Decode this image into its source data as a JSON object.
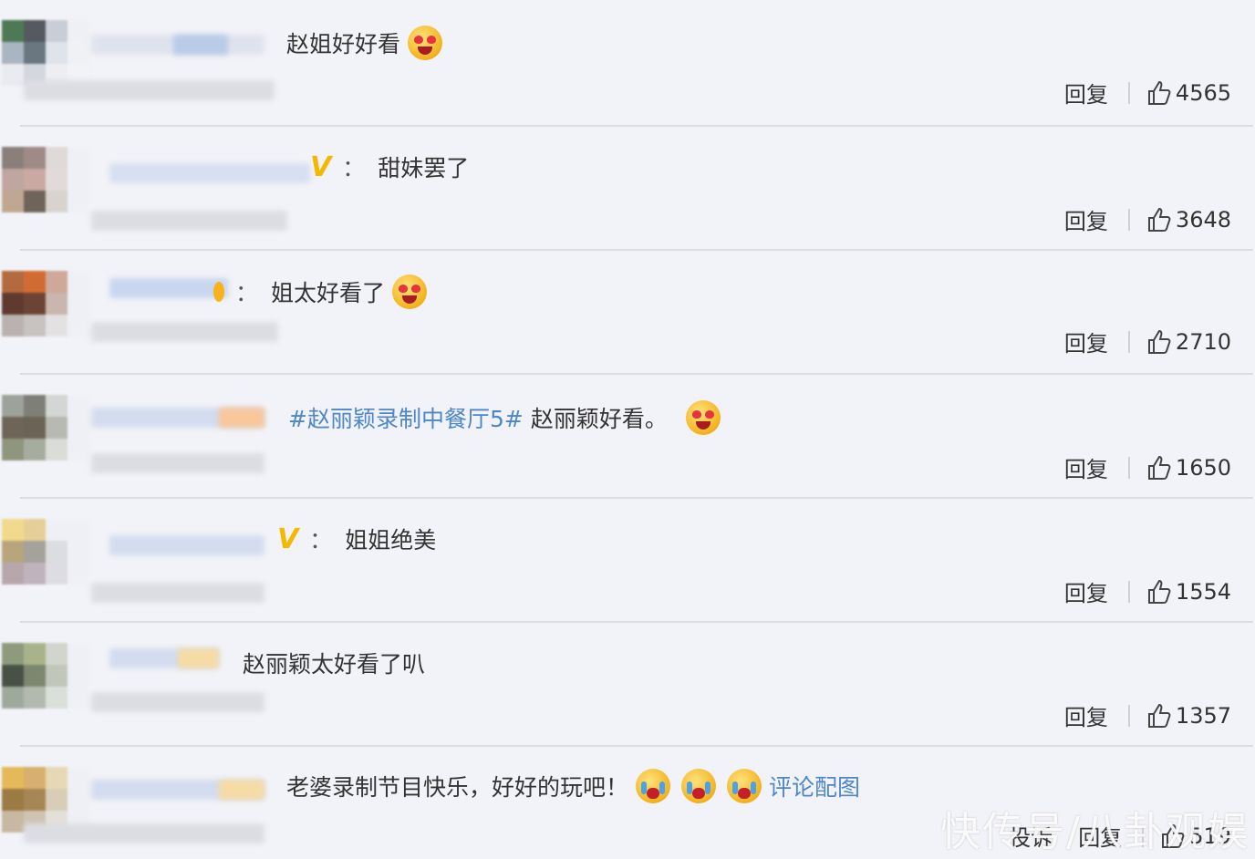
{
  "comments": [
    {
      "text": "赵姐好好看",
      "emojis": [
        "heart-eyes"
      ],
      "reply_label": "回复",
      "likes": "4565",
      "avatar_colors": [
        "#4d7a55",
        "#555a60",
        "#c9cdd6",
        "#eef0f5",
        "#a9b5c0",
        "#6a7781",
        "#dfe3ea",
        "#f0f1f5",
        "#e9ebf0",
        "#d4d8de",
        "#eceef2",
        "#f2f3f6"
      ]
    },
    {
      "vmark": "V",
      "colon": "：",
      "text": "甜妹罢了",
      "reply_label": "回复",
      "likes": "3648",
      "avatar_colors": [
        "#8a7f7a",
        "#9f8a88",
        "#dfd9d8",
        "#eef0f5",
        "#bfa6a0",
        "#c9a9a2",
        "#e2dad8",
        "#eef0f5",
        "#c0a792",
        "#6f6459",
        "#d8d3cf",
        "#eef0f5"
      ]
    },
    {
      "colon": "：",
      "text": "姐太好看了",
      "emojis": [
        "laugh"
      ],
      "reply_label": "回复",
      "likes": "2710",
      "avatar_colors": [
        "#b46a3e",
        "#d26b32",
        "#cfa89a",
        "#eef0f5",
        "#5e3b2e",
        "#6c4436",
        "#c9b6ae",
        "#eef0f5",
        "#b9b2b0",
        "#c8c2c1",
        "#e3e1e2",
        "#eef0f5"
      ]
    },
    {
      "hashtag": "#赵丽颖录制中餐厅5#",
      "text": "赵丽颖好看。",
      "emojis": [
        "laugh"
      ],
      "reply_label": "回复",
      "likes": "1650",
      "avatar_colors": [
        "#9da29a",
        "#7e8077",
        "#d3d6d2",
        "#eef0f5",
        "#6e6458",
        "#6b6356",
        "#b7b9b2",
        "#eef0f5",
        "#8f967d",
        "#a7ad9e",
        "#dadcd8",
        "#eef0f5"
      ]
    },
    {
      "vmark": "V",
      "colon": "：",
      "text": "姐姐绝美",
      "reply_label": "回复",
      "likes": "1554",
      "avatar_colors": [
        "#f1d98e",
        "#e6cf97",
        "#eef0f5",
        "#eef0f5",
        "#b8a57d",
        "#a4a29b",
        "#dcdde0",
        "#eef0f5",
        "#b7a7ad",
        "#bfb4be",
        "#dedce3",
        "#eef0f5"
      ]
    },
    {
      "text": "赵丽颖太好看了叭",
      "reply_label": "回复",
      "likes": "1357",
      "avatar_colors": [
        "#8f9a7c",
        "#a9b38a",
        "#d1d5cc",
        "#eef0f5",
        "#475146",
        "#7d876f",
        "#c1c6bb",
        "#eef0f5",
        "#9ea99b",
        "#b2bab0",
        "#dadfd9",
        "#eef0f5"
      ]
    },
    {
      "text": "老婆录制节目快乐，好好的玩吧！",
      "emojis": [
        "cry",
        "cry",
        "cry"
      ],
      "link": "评论配图",
      "reply_label": "回复",
      "report_label": "投诉",
      "likes": "519",
      "avatar_colors": [
        "#e5b85a",
        "#d7b070",
        "#e7d8b5",
        "#eef0f5",
        "#9b7a44",
        "#a78656",
        "#d8cdb6",
        "#eef0f5",
        "#c7b8a1",
        "#cfc3b2",
        "#e4e0d9",
        "#eef0f5"
      ]
    }
  ],
  "watermark": "快传号/八卦观娱"
}
